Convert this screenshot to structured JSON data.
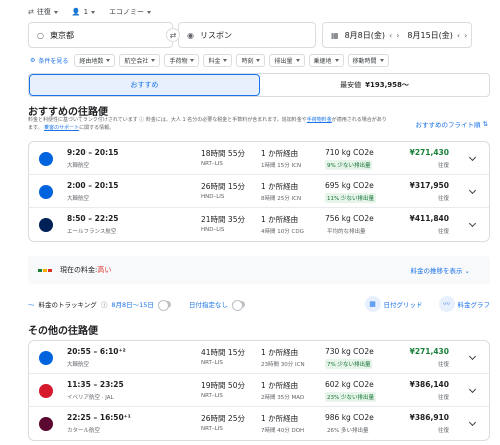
{
  "trip": {
    "type": "往復",
    "passengers": "1",
    "cabin": "エコノミー"
  },
  "search": {
    "from": "東京都",
    "to": "リスボン",
    "depart": "8月8日(金)",
    "return": "8月15日(金)"
  },
  "filters": {
    "condition": "条件を見る",
    "items": [
      "経由地数",
      "航空会社",
      "手荷物",
      "料金",
      "時刻",
      "排出量",
      "乗継地",
      "移動時間"
    ]
  },
  "tabs": {
    "recommended": "おすすめ",
    "cheapest_label": "最安値",
    "cheapest_price": "¥193,958〜"
  },
  "top": {
    "title": "おすすめの往路便",
    "notice_line1": "料金と利便性に基づいてランク付けされています",
    "notice_line2": "料金には、大人 1 名分の必要な税金と手数料が含まれます。追加料金や",
    "notice_link": "手荷物料金",
    "notice_line3": "が適用される場合があります。",
    "notice_link2": "乗客のサポート",
    "notice_line4": "に関する情報。",
    "link": "おすすめのフライト順"
  },
  "top_flights": [
    {
      "time": "9:20 – 20:15",
      "airline": "大韓航空",
      "duration": "18時間 55分",
      "route": "NRT–LIS",
      "stops": "1 か所経由",
      "stop_detail": "1時間 15分 ICN",
      "co2": "710 kg CO2e",
      "co2_note": "9% 少ない排出量",
      "co2_green": true,
      "price": "¥271,430",
      "price_type": "往復",
      "price_green": true,
      "logo": "KE"
    },
    {
      "time": "2:00 – 20:15",
      "airline": "大韓航空",
      "duration": "26時間 15分",
      "route": "HND–LIS",
      "stops": "1 か所経由",
      "stop_detail": "8時間 25分 ICN",
      "co2": "695 kg CO2e",
      "co2_note": "11% 少ない排出量",
      "co2_green": true,
      "price": "¥317,950",
      "price_type": "往復",
      "price_green": false,
      "logo": "KE"
    },
    {
      "time": "8:50 – 22:25",
      "airline": "エールフランス航空",
      "duration": "21時間 35分",
      "route": "HND–LIS",
      "stops": "1 か所経由",
      "stop_detail": "4時間 10分 CDG",
      "co2": "756 kg CO2e",
      "co2_note": "平均的な排出量",
      "co2_green": false,
      "price": "¥411,840",
      "price_type": "往復",
      "price_green": false,
      "logo": "AF"
    }
  ],
  "price_level": {
    "label": "現在の料金:",
    "level": "高い",
    "history": "料金の推移を表示"
  },
  "tracking": {
    "label": "料金のトラッキング",
    "dates": "8月8日～15日",
    "any_dates": "日付指定なし",
    "date_grid": "日付グリッド",
    "price_graph": "料金グラフ"
  },
  "other": {
    "title": "その他の往路便"
  },
  "other_flights": [
    {
      "time": "20:55 – 6:10⁺²",
      "airline": "大韓航空",
      "duration": "41時間 15分",
      "route": "NRT–LIS",
      "stops": "1 か所経由",
      "stop_detail": "23時間 30分 ICN",
      "co2": "730 kg CO2e",
      "co2_note": "7% 少ない排出量",
      "co2_green": true,
      "price": "¥271,430",
      "price_type": "往復",
      "price_green": true,
      "logo": "KE"
    },
    {
      "time": "11:35 – 23:25",
      "airline": "イベリア航空 · JAL",
      "duration": "19時間 50分",
      "route": "NRT–LIS",
      "stops": "1 か所経由",
      "stop_detail": "2時間 35分 MAD",
      "co2": "602 kg CO2e",
      "co2_note": "23% 少ない排出量",
      "co2_green": true,
      "price": "¥386,140",
      "price_type": "往復",
      "price_green": false,
      "logo": "IB"
    },
    {
      "time": "22:25 – 16:50⁺¹",
      "airline": "カタール航空",
      "duration": "26時間 25分",
      "route": "NRT–LIS",
      "stops": "1 か所経由",
      "stop_detail": "7時間 40分 DOH",
      "co2": "986 kg CO2e",
      "co2_note": "26% 多い排出量",
      "co2_green": false,
      "price": "¥386,910",
      "price_type": "往復",
      "price_green": false,
      "logo": "QR"
    }
  ],
  "colors": {
    "accent": "#1a73e8",
    "green": "#188038",
    "korean": "#0064de",
    "af": "#002157",
    "ib": "#d7192d",
    "qr": "#5c0632"
  }
}
